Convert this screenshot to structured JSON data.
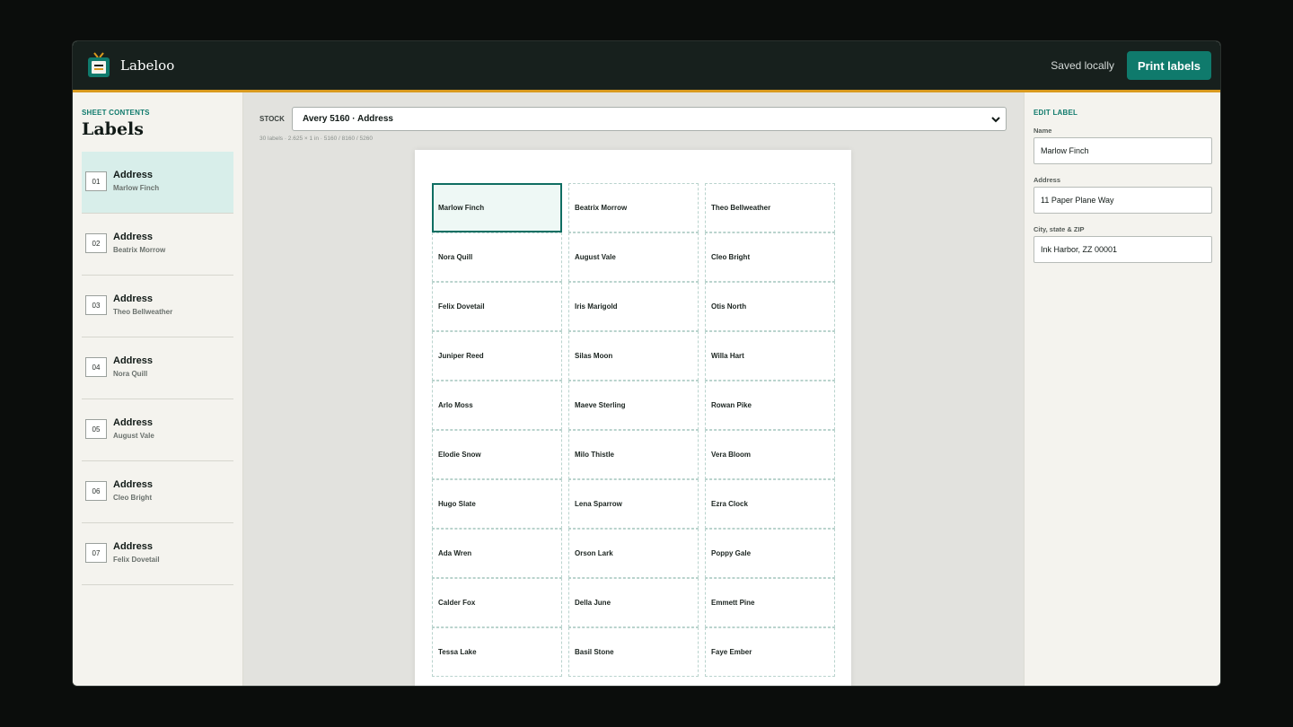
{
  "app": {
    "name": "Labeloo",
    "logo_icon": "tv-label-icon"
  },
  "header": {
    "status": "Saved locally",
    "print_label": "Print labels"
  },
  "sidebar": {
    "eyebrow": "SHEET CONTENTS",
    "title": "Labels",
    "items": [
      {
        "num": "01",
        "title": "Address",
        "sub": "Marlow Finch",
        "active": true
      },
      {
        "num": "02",
        "title": "Address",
        "sub": "Beatrix Morrow"
      },
      {
        "num": "03",
        "title": "Address",
        "sub": "Theo Bellweather"
      },
      {
        "num": "04",
        "title": "Address",
        "sub": "Nora Quill"
      },
      {
        "num": "05",
        "title": "Address",
        "sub": "August Vale"
      },
      {
        "num": "06",
        "title": "Address",
        "sub": "Cleo Bright"
      },
      {
        "num": "07",
        "title": "Address",
        "sub": "Felix Dovetail"
      }
    ]
  },
  "stock": {
    "label": "STOCK",
    "selected": "Avery 5160 · Address",
    "meta": "30 labels · 2.625 × 1 in · 5160 / 8160 / 5260"
  },
  "sheet": {
    "labels": [
      "Marlow Finch",
      "Beatrix Morrow",
      "Theo Bellweather",
      "Nora Quill",
      "August Vale",
      "Cleo Bright",
      "Felix Dovetail",
      "Iris Marigold",
      "Otis North",
      "Juniper Reed",
      "Silas Moon",
      "Willa Hart",
      "Arlo Moss",
      "Maeve Sterling",
      "Rowan Pike",
      "Elodie Snow",
      "Milo Thistle",
      "Vera Bloom",
      "Hugo Slate",
      "Lena Sparrow",
      "Ezra Clock",
      "Ada Wren",
      "Orson Lark",
      "Poppy Gale",
      "Calder Fox",
      "Della June",
      "Emmett Pine",
      "Tessa Lake",
      "Basil Stone",
      "Faye Ember"
    ],
    "selected_index": 0
  },
  "editor": {
    "eyebrow": "EDIT LABEL",
    "name_label": "Name",
    "name_value": "Marlow Finch",
    "address_label": "Address",
    "address_value": "11 Paper Plane Way",
    "city_label": "City, state & ZIP",
    "city_value": "Ink Harbor, ZZ 00001"
  },
  "colors": {
    "accent": "#0f7a6c",
    "header_bg": "#17201d",
    "header_rule": "#d99a1e"
  }
}
